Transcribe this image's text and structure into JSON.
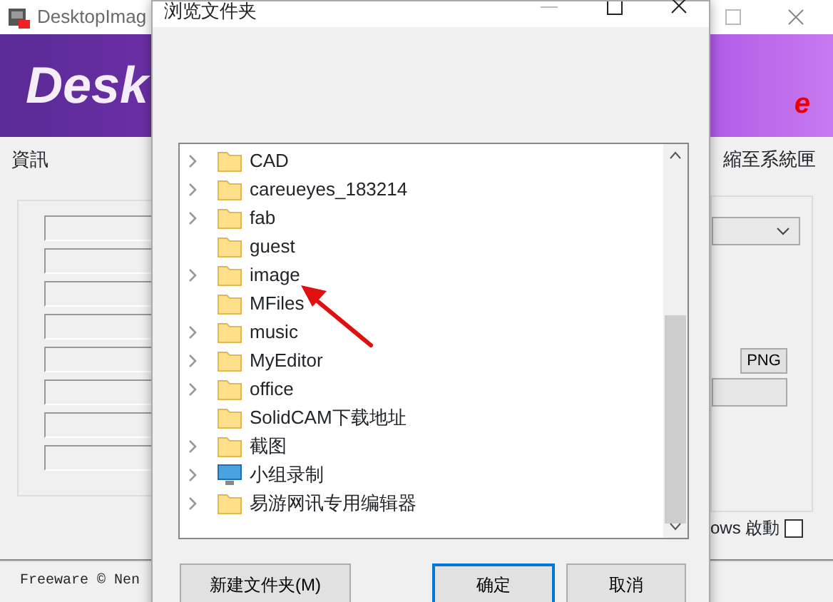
{
  "background_window": {
    "title": "DesktopImag",
    "banner_text": "Desk",
    "banner_tail": "e",
    "info_label": "資訊",
    "tray_label": "縮至系統匣",
    "format_button": "PNG",
    "startup": {
      "label": "ows 啟動",
      "checked": false
    },
    "footer": "Freeware © Nen"
  },
  "dialog": {
    "title": "浏览文件夹",
    "folders": [
      {
        "label": "CAD",
        "kind": "folder",
        "expandable": true,
        "selected": false
      },
      {
        "label": "careueyes_183214",
        "kind": "folder",
        "expandable": true,
        "selected": false
      },
      {
        "label": "fab",
        "kind": "folder",
        "expandable": true,
        "selected": false
      },
      {
        "label": "guest",
        "kind": "folder",
        "expandable": false,
        "selected": false
      },
      {
        "label": "image",
        "kind": "folder",
        "expandable": true,
        "selected": false
      },
      {
        "label": "MFiles",
        "kind": "folder",
        "expandable": false,
        "selected": false
      },
      {
        "label": "music",
        "kind": "folder",
        "expandable": true,
        "selected": false
      },
      {
        "label": "MyEditor",
        "kind": "folder",
        "expandable": true,
        "selected": false
      },
      {
        "label": "office",
        "kind": "folder",
        "expandable": true,
        "selected": false
      },
      {
        "label": "SolidCAM下载地址",
        "kind": "folder",
        "expandable": false,
        "selected": false
      },
      {
        "label": "截图",
        "kind": "folder",
        "expandable": true,
        "selected": false
      },
      {
        "label": "小组录制",
        "kind": "computer",
        "expandable": true,
        "selected": false
      },
      {
        "label": "易游网讯专用编辑器",
        "kind": "folder",
        "expandable": true,
        "selected": false
      }
    ],
    "buttons": [
      {
        "label": "新建文件夹(M)",
        "default": false
      },
      {
        "label": "确定",
        "default": true
      },
      {
        "label": "取消",
        "default": false
      }
    ]
  }
}
